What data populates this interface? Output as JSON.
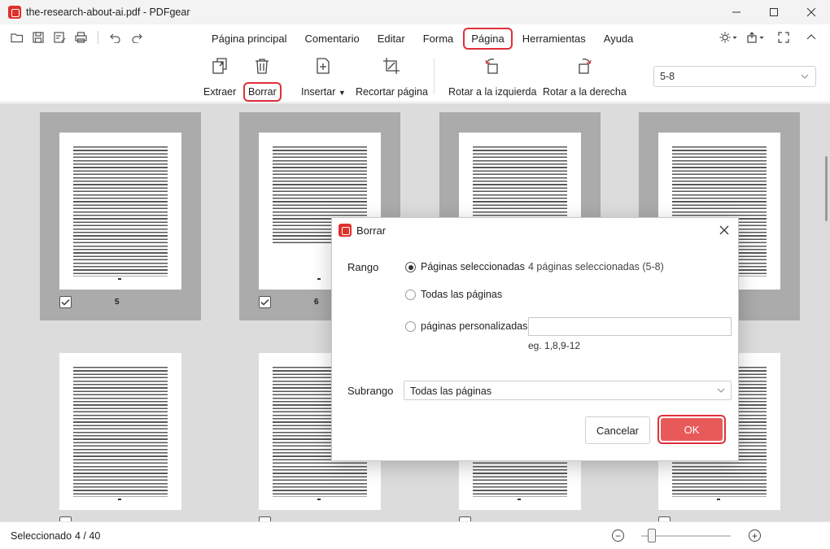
{
  "window": {
    "title": "the-research-about-ai.pdf - PDFgear"
  },
  "menu": {
    "items": [
      {
        "label": "Página principal"
      },
      {
        "label": "Comentario"
      },
      {
        "label": "Editar"
      },
      {
        "label": "Forma"
      },
      {
        "label": "Página",
        "active": true
      },
      {
        "label": "Herramientas"
      },
      {
        "label": "Ayuda"
      }
    ]
  },
  "ribbon": {
    "extract": "Extraer",
    "delete": "Borrar",
    "insert": "Insertar",
    "crop": "Recortar página",
    "rotate_left": "Rotar a la izquierda",
    "rotate_right": "Rotar a la derecha",
    "page_range": "5-8"
  },
  "pages": [
    {
      "number": "5",
      "selected": true
    },
    {
      "number": "6",
      "selected": true
    },
    {
      "number": "",
      "selected": true
    },
    {
      "number": "",
      "selected": true
    },
    {
      "number": "",
      "selected": false
    },
    {
      "number": "",
      "selected": false
    },
    {
      "number": "",
      "selected": false
    },
    {
      "number": "",
      "selected": false
    }
  ],
  "status": {
    "label": "Seleccionado",
    "count": "4 / 40"
  },
  "dialog": {
    "title": "Borrar",
    "range_label": "Rango",
    "option_selected": "Páginas seleccionadas",
    "selected_info": "4  páginas seleccionadas (5-8)",
    "option_all": "Todas las páginas",
    "option_custom": "páginas personalizadas",
    "custom_value": "",
    "custom_hint": "eg. 1,8,9-12",
    "subrange_label": "Subrango",
    "subrange_value": "Todas las páginas",
    "cancel": "Cancelar",
    "ok": "OK"
  },
  "colors": {
    "accent": "#e0303a",
    "ok_button": "#e85a5a",
    "workspace": "#dcdcdc"
  }
}
